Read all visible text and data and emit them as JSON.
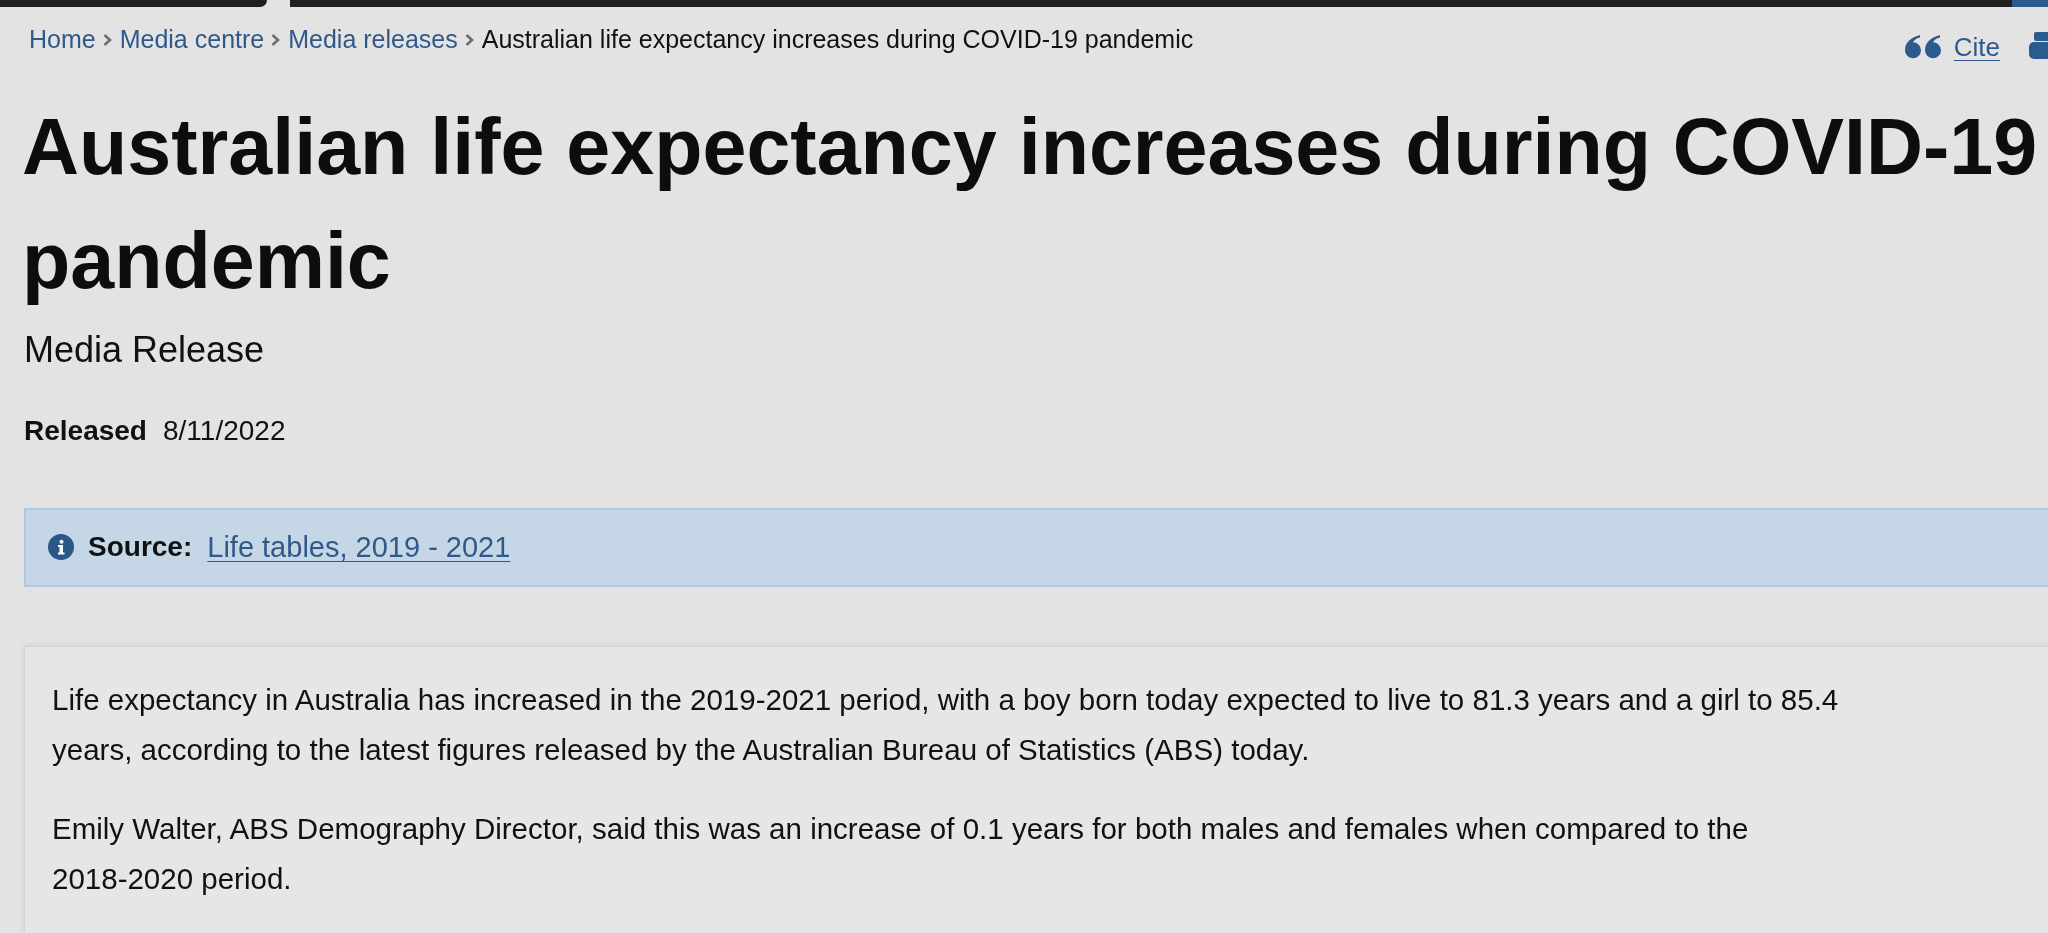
{
  "breadcrumb": [
    {
      "label": "Home",
      "kind": "link"
    },
    {
      "label": "Media centre",
      "kind": "link"
    },
    {
      "label": "Media releases",
      "kind": "link"
    },
    {
      "label": "Australian life expectancy increases during COVID-19 pandemic",
      "kind": "current"
    }
  ],
  "actions": {
    "cite": "Cite"
  },
  "title": "Australian life expectancy increases during COVID-19 pandemic",
  "subtitle": "Media Release",
  "released": {
    "label": "Released",
    "date": "8/11/2022"
  },
  "source": {
    "label": "Source:",
    "link": "Life tables, 2019 - 2021"
  },
  "body": {
    "paragraphs": [
      "Life expectancy in Australia has increased in the 2019-2021 period, with a boy born today expected to live to 81.3 years and a girl to 85.4 years, according to the latest figures released by the Australian Bureau of Statistics (ABS) today.",
      "Emily Walter, ABS Demography Director, said this was an increase of 0.1 years for both males and females when compared to the 2018-2020 period."
    ]
  }
}
